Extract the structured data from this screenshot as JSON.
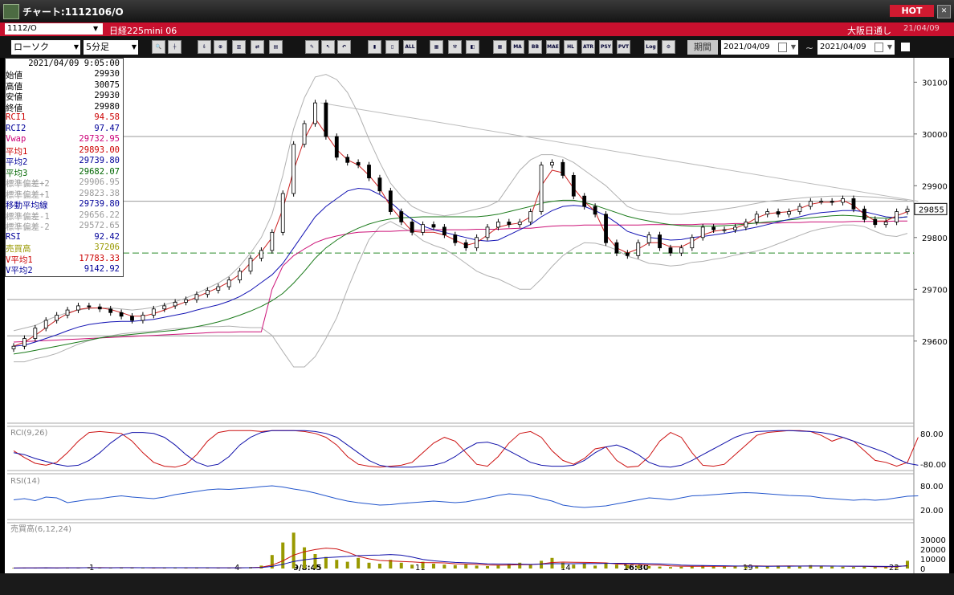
{
  "window": {
    "title": "チャート:1112106/O",
    "hot_label": "HOT"
  },
  "symbol": {
    "code": "1112/O",
    "name": "日経225mini 06",
    "exchange": "大阪日通し",
    "date": "21/04/09"
  },
  "toolbar": {
    "chart_type": "ローソク",
    "interval": "5分足",
    "period_label": "期間",
    "date_from": "2021/04/09",
    "date_to": "2021/04/09",
    "tilde": "~",
    "indicator_buttons": [
      "MA",
      "BB",
      "MAE",
      "HL",
      "ATR",
      "PSY",
      "PVT",
      "Log"
    ],
    "all_label": "ALL"
  },
  "info_panel": {
    "datetime": "2021/04/09 9:05:00",
    "rows": [
      {
        "label": "始値",
        "value": "29930",
        "color": "#000000"
      },
      {
        "label": "高値",
        "value": "30075",
        "color": "#000000"
      },
      {
        "label": "安値",
        "value": "29930",
        "color": "#000000"
      },
      {
        "label": "終値",
        "value": "29980",
        "color": "#000000"
      },
      {
        "label": "RCI1",
        "value": "94.58",
        "color": "#cc0000"
      },
      {
        "label": "RCI2",
        "value": "97.47",
        "color": "#000099"
      },
      {
        "label": "Vwap",
        "value": "29732.95",
        "color": "#cc0077"
      },
      {
        "label": "平均1",
        "value": "29893.00",
        "color": "#cc0000"
      },
      {
        "label": "平均2",
        "value": "29739.80",
        "color": "#000099"
      },
      {
        "label": "平均3",
        "value": "29682.07",
        "color": "#006600"
      },
      {
        "label": "標準偏差+2",
        "value": "29906.95",
        "color": "#999999"
      },
      {
        "label": "標準偏差+1",
        "value": "29823.38",
        "color": "#999999"
      },
      {
        "label": "移動平均線",
        "value": "29739.80",
        "color": "#000099"
      },
      {
        "label": "標準偏差-1",
        "value": "29656.22",
        "color": "#999999"
      },
      {
        "label": "標準偏差-2",
        "value": "29572.65",
        "color": "#999999"
      },
      {
        "label": "RSI",
        "value": "92.42",
        "color": "#000099"
      },
      {
        "label": "売買高",
        "value": "37206",
        "color": "#999900"
      },
      {
        "label": "V平均1",
        "value": "17783.33",
        "color": "#cc0000"
      },
      {
        "label": "V平均2",
        "value": "9142.92",
        "color": "#000099"
      }
    ]
  },
  "chart_data": [
    {
      "type": "candlestick",
      "title": "",
      "ylim": [
        29550,
        30130
      ],
      "y_ticks": [
        "30100",
        "30000",
        "29900",
        "29800",
        "29700",
        "29600"
      ],
      "x_ticks": [
        "1",
        "4",
        "9/8:45",
        "11",
        "14",
        "16:30",
        "19",
        "22"
      ],
      "last_price": "29855",
      "close": [
        29590,
        29605,
        29625,
        29640,
        29650,
        29660,
        29668,
        29666,
        29662,
        29655,
        29648,
        29640,
        29650,
        29662,
        29668,
        29675,
        29680,
        29690,
        29698,
        29705,
        29718,
        29735,
        29760,
        29775,
        29810,
        29885,
        29980,
        30020,
        30060,
        29995,
        29955,
        29945,
        29940,
        29915,
        29890,
        29850,
        29830,
        29810,
        29825,
        29820,
        29805,
        29790,
        29780,
        29800,
        29820,
        29830,
        29825,
        29830,
        29850,
        29940,
        29945,
        29920,
        29880,
        29860,
        29845,
        29790,
        29770,
        29765,
        29790,
        29805,
        29780,
        29770,
        29780,
        29800,
        29820,
        29815,
        29815,
        29820,
        29830,
        29845,
        29850,
        29845,
        29850,
        29860,
        29870,
        29870,
        29868,
        29875,
        29855,
        29835,
        29825,
        29830,
        29850,
        29855
      ],
      "mav": [
        29590,
        29598,
        29611,
        29626,
        29641,
        29653,
        29661,
        29664,
        29664,
        29661,
        29655,
        29648,
        29648,
        29653,
        29660,
        29668,
        29676,
        29685,
        29694,
        29703,
        29714,
        29729,
        29751,
        29772,
        29800,
        29855,
        29930,
        29990,
        30030,
        30000,
        29970,
        29950,
        29940,
        29920,
        29895,
        29860,
        29835,
        29812,
        29810,
        29810,
        29805,
        29795,
        29785,
        29790,
        29805,
        29820,
        29825,
        29828,
        29840,
        29900,
        29930,
        29925,
        29895,
        29870,
        29850,
        29805,
        29780,
        29770,
        29778,
        29790,
        29790,
        29782,
        29782,
        29792,
        29805,
        29812,
        29815,
        29818,
        29826,
        29838,
        29846,
        29848,
        29850,
        29856,
        29864,
        29868,
        29868,
        29872,
        29862,
        29845,
        29832,
        29832,
        29842,
        29850
      ],
      "mid": [
        29590,
        29592,
        29598,
        29605,
        29612,
        29620,
        29627,
        29632,
        29635,
        29637,
        29638,
        29638,
        29640,
        29642,
        29646,
        29650,
        29654,
        29660,
        29665,
        29670,
        29677,
        29686,
        29698,
        29713,
        29728,
        29750,
        29780,
        29810,
        29840,
        29860,
        29875,
        29890,
        29895,
        29893,
        29883,
        29868,
        29850,
        29835,
        29822,
        29815,
        29810,
        29805,
        29800,
        29795,
        29793,
        29795,
        29805,
        29815,
        29825,
        29840,
        29852,
        29860,
        29862,
        29860,
        29852,
        29842,
        29828,
        29812,
        29805,
        29800,
        29798,
        29795,
        29796,
        29800,
        29802,
        29805,
        29808,
        29812,
        29816,
        29820,
        29825,
        29830,
        29835,
        29840,
        29845,
        29848,
        29850,
        29852,
        29852,
        29850,
        29845,
        29840,
        29838,
        29840
      ],
      "ma3": [
        29575,
        29578,
        29582,
        29586,
        29590,
        29594,
        29598,
        29602,
        29606,
        29609,
        29611,
        29613,
        29615,
        29617,
        29619,
        29621,
        29624,
        29628,
        29632,
        29637,
        29643,
        29650,
        29658,
        29667,
        29678,
        29692,
        29712,
        29735,
        29760,
        29780,
        29795,
        29808,
        29818,
        29826,
        29832,
        29836,
        29838,
        29839,
        29840,
        29840,
        29840,
        29840,
        29840,
        29840,
        29842,
        29845,
        29850,
        29855,
        29860,
        29866,
        29870,
        29872,
        29872,
        29868,
        29862,
        29855,
        29848,
        29841,
        29836,
        29832,
        29828,
        29825,
        29823,
        29822,
        29822,
        29822,
        29823,
        29824,
        29826,
        29828,
        29830,
        29832,
        29834,
        29836,
        29838,
        29840,
        29842,
        29843,
        29842,
        29840,
        29838,
        29837,
        29838,
        29840
      ],
      "vwap": [
        29598,
        29599,
        29600,
        29601,
        29602,
        29603,
        29604,
        29605,
        29606,
        29607,
        29608,
        29609,
        29610,
        29611,
        29612,
        29613,
        29614,
        29615,
        29616,
        29617,
        29617,
        29618,
        29618,
        29618,
        29700,
        29745,
        29765,
        29778,
        29790,
        29798,
        29803,
        29807,
        29810,
        29811,
        29812,
        29812,
        29813,
        29814,
        29814,
        29815,
        29815,
        29815,
        29815,
        29816,
        29816,
        29816,
        29817,
        29818,
        29818,
        29820,
        29822,
        29823,
        29823,
        29824,
        29824,
        29824,
        29824,
        29824,
        29824,
        29825,
        29825,
        29825,
        29825,
        29825,
        29826,
        29826,
        29826,
        29827,
        29827,
        29828,
        29828,
        29828,
        29829,
        29829,
        29830,
        29830,
        29830,
        29830,
        29831,
        29831,
        29831,
        29831,
        29832,
        29832
      ],
      "bb_upper": [
        29620,
        29625,
        29630,
        29640,
        29648,
        29655,
        29660,
        29663,
        29664,
        29664,
        29662,
        29660,
        29662,
        29665,
        29670,
        29676,
        29683,
        29692,
        29702,
        29712,
        29725,
        29745,
        29770,
        29800,
        29845,
        29920,
        30010,
        30070,
        30110,
        30115,
        30105,
        30080,
        30040,
        29990,
        29945,
        29905,
        29880,
        29860,
        29850,
        29845,
        29842,
        29845,
        29850,
        29855,
        29860,
        29870,
        29900,
        29930,
        29950,
        29960,
        29960,
        29955,
        29945,
        29930,
        29915,
        29900,
        29880,
        29860,
        29852,
        29850,
        29848,
        29845,
        29845,
        29848,
        29850,
        29852,
        29855,
        29858,
        29862,
        29866,
        29870,
        29872,
        29874,
        29876,
        29878,
        29879,
        29880,
        29880,
        29880,
        29879,
        29878,
        29876,
        29874,
        29872
      ],
      "bb_lower": [
        29560,
        29560,
        29566,
        29570,
        29576,
        29585,
        29594,
        29601,
        29606,
        29610,
        29614,
        29616,
        29618,
        29619,
        29622,
        29624,
        29625,
        29628,
        29628,
        29628,
        29629,
        29627,
        29626,
        29626,
        29611,
        29580,
        29550,
        29550,
        29570,
        29605,
        29645,
        29700,
        29750,
        29796,
        29821,
        29831,
        29820,
        29810,
        29794,
        29785,
        29778,
        29765,
        29750,
        29735,
        29726,
        29720,
        29710,
        29700,
        29700,
        29720,
        29744,
        29765,
        29779,
        29790,
        29789,
        29784,
        29776,
        29764,
        29758,
        29750,
        29748,
        29745,
        29747,
        29752,
        29754,
        29758,
        29761,
        29766,
        29770,
        29774,
        29780,
        29788,
        29796,
        29804,
        29812,
        29817,
        29820,
        29824,
        29824,
        29821,
        29812,
        29804,
        29802,
        29808
      ],
      "trendline": [
        [
          28.5,
          30060
        ],
        [
          84,
          29870
        ]
      ],
      "dashed_level": 29770,
      "hlines": [
        29995,
        29870,
        29680,
        29610
      ]
    },
    {
      "type": "line",
      "title": "RCI(9,26)",
      "y_ticks": [
        "80.00",
        "-80.00"
      ],
      "ylim": [
        -100,
        100
      ],
      "series": [
        {
          "values": [
            -10,
            -45,
            -75,
            -85,
            -70,
            -20,
            40,
            85,
            90,
            85,
            80,
            40,
            -20,
            -70,
            -90,
            -95,
            -80,
            -30,
            40,
            85,
            95,
            95,
            95,
            90,
            95,
            95,
            95,
            90,
            80,
            60,
            20,
            -40,
            -80,
            -90,
            -95,
            -90,
            -85,
            -70,
            -20,
            30,
            60,
            40,
            -20,
            -80,
            -90,
            -40,
            30,
            80,
            90,
            60,
            -10,
            -60,
            -80,
            -50,
            0,
            10,
            -60,
            -95,
            -90,
            -40,
            40,
            85,
            60,
            -20,
            -85,
            -90,
            -80,
            -30,
            20,
            70,
            85,
            90,
            95,
            95,
            90,
            70,
            40,
            60,
            40,
            -10,
            -60,
            -70,
            -90,
            -70,
            60
          ]
        },
        {
          "values": [
            -20,
            -30,
            -50,
            -65,
            -80,
            -90,
            -85,
            -60,
            -20,
            30,
            70,
            85,
            85,
            80,
            60,
            20,
            -30,
            -70,
            -90,
            -80,
            -40,
            20,
            60,
            85,
            95,
            95,
            95,
            95,
            90,
            80,
            60,
            20,
            -20,
            -60,
            -85,
            -95,
            -95,
            -95,
            -90,
            -85,
            -70,
            -40,
            0,
            30,
            35,
            20,
            -10,
            -40,
            -70,
            -85,
            -90,
            -90,
            -85,
            -60,
            -20,
            10,
            20,
            0,
            -30,
            -70,
            -90,
            -95,
            -85,
            -60,
            -30,
            0,
            30,
            60,
            80,
            90,
            92,
            95,
            95,
            92,
            90,
            85,
            75,
            60,
            40,
            20,
            0,
            -20,
            -50,
            -75,
            -85
          ]
        }
      ]
    },
    {
      "type": "line",
      "title": "RSI(14)",
      "y_ticks": [
        "80.00",
        "20.00"
      ],
      "ylim": [
        0,
        100
      ],
      "series": [
        {
          "values": [
            45,
            48,
            43,
            52,
            50,
            38,
            42,
            46,
            48,
            52,
            55,
            52,
            50,
            48,
            52,
            58,
            62,
            66,
            70,
            72,
            71,
            73,
            75,
            78,
            80,
            77,
            72,
            68,
            62,
            55,
            48,
            42,
            38,
            35,
            32,
            33,
            36,
            38,
            40,
            42,
            40,
            38,
            40,
            45,
            50,
            56,
            60,
            58,
            55,
            48,
            42,
            32,
            28,
            26,
            28,
            30,
            35,
            40,
            45,
            50,
            48,
            45,
            50,
            55,
            56,
            58,
            60,
            62,
            63,
            62,
            60,
            58,
            56,
            55,
            54,
            50,
            48,
            46,
            44,
            46,
            44,
            46,
            50,
            54,
            55
          ]
        }
      ]
    },
    {
      "type": "bar",
      "title": "売買高(6,12,24)",
      "y_ticks": [
        "30000",
        "20000",
        "10000",
        "0"
      ],
      "ylim": [
        0,
        40000
      ],
      "values": [
        500,
        800,
        400,
        1200,
        600,
        900,
        700,
        1500,
        500,
        800,
        1200,
        600,
        400,
        700,
        900,
        1100,
        700,
        500,
        600,
        800,
        900,
        1000,
        1500,
        3000,
        14000,
        27000,
        37206,
        22000,
        15000,
        12000,
        9000,
        7000,
        11000,
        6000,
        5000,
        9000,
        6000,
        4000,
        7000,
        5000,
        4000,
        3500,
        4000,
        3000,
        2500,
        3500,
        5000,
        6000,
        4000,
        8000,
        11000,
        6000,
        4000,
        5000,
        3000,
        6000,
        4000,
        3500,
        3000,
        2500,
        2000,
        1500,
        1800,
        2500,
        3000,
        2500,
        2000,
        2500,
        3500,
        2500,
        2000,
        3000,
        2500,
        2000,
        3500,
        2500,
        2000,
        1800,
        1500,
        2000,
        1500,
        1800,
        3000,
        8000
      ],
      "series": [
        {
          "name": "V平均1"
        },
        {
          "name": "V平均2"
        }
      ]
    }
  ]
}
